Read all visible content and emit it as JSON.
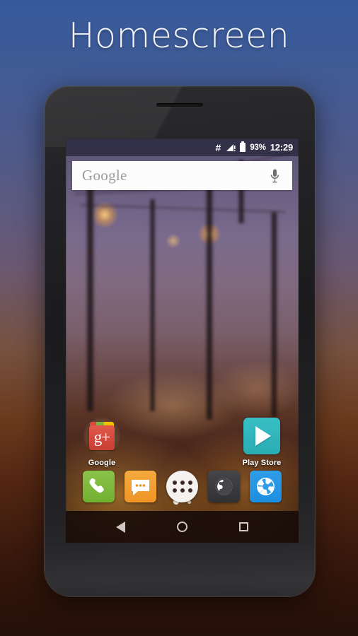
{
  "page": {
    "title": "Homescreen"
  },
  "phone": {
    "statusbar": {
      "hash_icon": "hash-icon",
      "signal_icon": "signal-bars-icon",
      "battery_icon": "battery-icon",
      "battery_percent": "93%",
      "clock": "12:29"
    },
    "search": {
      "placeholder": "Google",
      "mic_icon": "microphone-icon"
    },
    "apps": [
      {
        "label": "Google",
        "icon": "google-plus-folder-icon",
        "glyph": "g+"
      },
      {
        "label": "Play Store",
        "icon": "play-store-icon",
        "glyph": ""
      }
    ],
    "page_indicator": {
      "total": 2,
      "active_index": 0
    },
    "dock": [
      {
        "name": "phone",
        "icon": "phone-handset-icon",
        "color": "#8bc34a"
      },
      {
        "name": "messaging",
        "icon": "speech-bubble-icon",
        "color": "#f5a93f"
      },
      {
        "name": "app-drawer",
        "icon": "app-drawer-grid-icon",
        "color": "#f4f1ee"
      },
      {
        "name": "browser",
        "icon": "globe-icon",
        "color": "#46464a"
      },
      {
        "name": "camera",
        "icon": "camera-aperture-icon",
        "color": "#2f9de8"
      }
    ],
    "navbar": [
      {
        "name": "back",
        "icon": "triangle-back-icon"
      },
      {
        "name": "home",
        "icon": "circle-home-icon"
      },
      {
        "name": "recents",
        "icon": "square-recents-icon"
      }
    ]
  },
  "colors": {
    "background_top": "#37599c",
    "background_bottom": "#25100a",
    "accent_teal": "#37bfc4",
    "accent_red": "#d94c3d",
    "nav_icon": "#cfc7c4"
  }
}
